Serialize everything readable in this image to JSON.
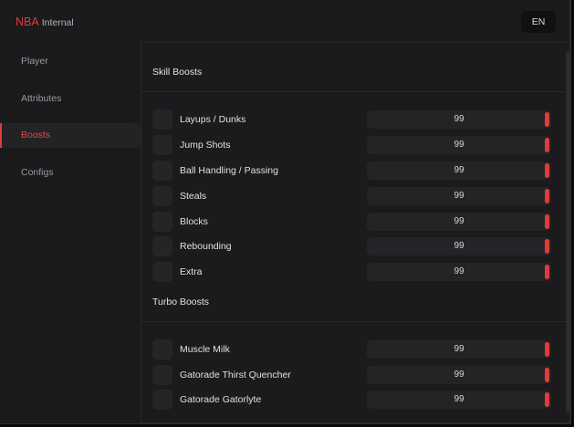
{
  "header": {
    "brand": "NBA",
    "subtitle": "Internal",
    "language": "EN"
  },
  "sidebar": {
    "items": [
      {
        "label": "Player"
      },
      {
        "label": "Attributes"
      },
      {
        "label": "Boosts",
        "active": true
      },
      {
        "label": "Configs"
      }
    ]
  },
  "skill_section": {
    "title": "Skill Boosts",
    "rows": [
      {
        "label": "Layups / Dunks",
        "value": "99",
        "level": 99
      },
      {
        "label": "Jump Shots",
        "value": "99",
        "level": 99
      },
      {
        "label": "Ball Handling / Passing",
        "value": "99",
        "level": 99
      },
      {
        "label": "Steals",
        "value": "99",
        "level": 99
      },
      {
        "label": "Blocks",
        "value": "99",
        "level": 99
      },
      {
        "label": "Rebounding",
        "value": "99",
        "level": 99
      },
      {
        "label": "Extra",
        "value": "99",
        "level": 99
      }
    ]
  },
  "turbo_section": {
    "title": "Turbo Boosts",
    "rows": [
      {
        "label": "Muscle Milk",
        "value": "99",
        "level": 99
      },
      {
        "label": "Gatorade Thirst Quencher",
        "value": "99",
        "level": 99
      },
      {
        "label": "Gatorade Gatorlyte",
        "value": "99",
        "level": 99
      }
    ]
  },
  "colors": {
    "accent": "#e23b3b",
    "background": "#1b1b1d",
    "panel": "#242427"
  }
}
